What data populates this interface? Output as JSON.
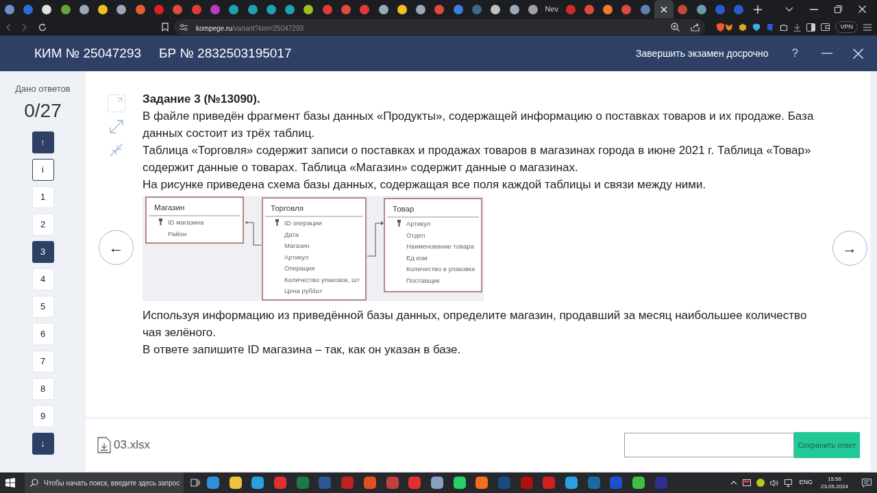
{
  "browser": {
    "tabs": [
      {
        "color": "#6d8fc9",
        "selected": false
      },
      {
        "color": "#2e6ad8",
        "selected": false
      },
      {
        "color": "#e0e0e0",
        "selected": false
      },
      {
        "color": "#6aa040",
        "selected": false
      },
      {
        "color": "#9aa8b8",
        "selected": false
      },
      {
        "color": "#f0c020",
        "selected": false
      },
      {
        "color": "#9aa8b8",
        "selected": false
      },
      {
        "color": "#e06030",
        "selected": false
      },
      {
        "color": "#e02020",
        "selected": false
      },
      {
        "color": "#e04a3a",
        "selected": false
      },
      {
        "color": "#e03a3a",
        "selected": false
      },
      {
        "color": "#c03ac0",
        "selected": false
      },
      {
        "color": "#20a0b0",
        "selected": false
      },
      {
        "color": "#20a0b0",
        "selected": false
      },
      {
        "color": "#20a0b0",
        "selected": false
      },
      {
        "color": "#20a0b0",
        "selected": false
      },
      {
        "color": "#a0c020",
        "selected": false
      },
      {
        "color": "#e03a3a",
        "selected": false
      },
      {
        "color": "#e04a3a",
        "selected": false
      },
      {
        "color": "#e03a3a",
        "selected": false
      },
      {
        "color": "#9aa8b8",
        "selected": false
      },
      {
        "color": "#f0c020",
        "selected": false
      },
      {
        "color": "#9aa8b8",
        "selected": false
      },
      {
        "color": "#e04a3a",
        "selected": false
      },
      {
        "color": "#3a80e0",
        "selected": false
      },
      {
        "color": "#3a6a90",
        "selected": false
      },
      {
        "color": "#c0c0c0",
        "selected": false
      },
      {
        "color": "#9aa8b8",
        "selected": false
      },
      {
        "color": "#a0a0a0",
        "selected": false
      },
      {
        "label": "Nev",
        "selected": false
      },
      {
        "color": "#d02a2a",
        "selected": false
      },
      {
        "color": "#e04a3a",
        "selected": false
      },
      {
        "color": "#f07a30",
        "selected": false
      },
      {
        "color": "#e04a3a",
        "selected": false
      },
      {
        "color": "#6080b0",
        "selected": false
      },
      {
        "selected": true
      },
      {
        "color": "#c04a3a",
        "selected": false
      },
      {
        "color": "#6a9aaa",
        "selected": false
      },
      {
        "color": "#2a5ad0",
        "selected": false
      },
      {
        "color": "#2a5ad0",
        "selected": false
      }
    ],
    "address": {
      "host": "kompege.ru",
      "path": "/variant?kim=25047293"
    },
    "vpn": "VPN"
  },
  "header": {
    "kim": "КИМ № 25047293",
    "br": "БР № 2832503195017",
    "finish": "Завершить экзамен досрочно",
    "help": "?"
  },
  "sidebar": {
    "caption": "Дано ответов",
    "count": "0/27",
    "up": "↑",
    "info": "i",
    "down": "↓",
    "items": [
      {
        "label": "1",
        "selected": false
      },
      {
        "label": "2",
        "selected": false
      },
      {
        "label": "3",
        "selected": true
      },
      {
        "label": "4",
        "selected": false
      },
      {
        "label": "5",
        "selected": false
      },
      {
        "label": "6",
        "selected": false
      },
      {
        "label": "7",
        "selected": false
      },
      {
        "label": "8",
        "selected": false
      },
      {
        "label": "9",
        "selected": false
      }
    ]
  },
  "nav": {
    "prev": "←",
    "next": "→"
  },
  "task": {
    "title": "Задание 3 (№13090).",
    "paragraphs": [
      "В файле приведён фрагмент базы данных «Продукты», содержащей информацию о поставках товаров и их продаже. База данных состоит из трёх таблиц.",
      "Таблица «Торговля» содержит записи о поставках и продажах товаров в магазинах города в июне 2021 г. Таблица «Товар» содержит данные о товарах. Таблица «Магазин» содержит данные о магазинах.",
      "На рисунке приведена схема базы данных, содержащая все поля каждой таблицы и связи между ними."
    ],
    "schema": {
      "tables": [
        {
          "name": "Магазин",
          "fields": [
            {
              "name": "ID магазина",
              "key": true
            },
            {
              "name": "Район",
              "key": false
            }
          ]
        },
        {
          "name": "Торговля",
          "fields": [
            {
              "name": "ID операции",
              "key": true
            },
            {
              "name": "Дата",
              "key": false
            },
            {
              "name": "Магазин",
              "key": false
            },
            {
              "name": "Артикул",
              "key": false
            },
            {
              "name": "Операция",
              "key": false
            },
            {
              "name": "Количество упаковок, шт",
              "key": false
            },
            {
              "name": "Цена руб/шт",
              "key": false
            }
          ]
        },
        {
          "name": "Товар",
          "fields": [
            {
              "name": "Артикул",
              "key": true
            },
            {
              "name": "Отдел",
              "key": false
            },
            {
              "name": "Наименование товара",
              "key": false
            },
            {
              "name": "Ед изм",
              "key": false
            },
            {
              "name": "Количество в упаковке",
              "key": false
            },
            {
              "name": "Поставщик",
              "key": false
            }
          ]
        }
      ]
    },
    "question": [
      "Используя информацию из приведённой базы данных, определите магазин, продавший за месяц наибольшее количество чая зелёного.",
      "В ответе запишите ID магазина – так, как он указан в базе."
    ]
  },
  "footer": {
    "file": "03.xlsx",
    "save_button": "Сохранить ответ"
  },
  "taskbar": {
    "search_placeholder": "Чтобы начать поиск, введите здесь запрос",
    "apps": [
      {
        "color": "#2f8fd8"
      },
      {
        "color": "#f0c040"
      },
      {
        "color": "#2aa0e0"
      },
      {
        "color": "#e03030"
      },
      {
        "color": "#1d7a45"
      },
      {
        "color": "#2b5797"
      },
      {
        "color": "#c02020"
      },
      {
        "color": "#e05020"
      },
      {
        "color": "#c04040"
      },
      {
        "color": "#e03030"
      },
      {
        "color": "#8aa0c0"
      },
      {
        "color": "#25d366"
      },
      {
        "color": "#f07020"
      },
      {
        "color": "#1a4a80"
      },
      {
        "color": "#b01010"
      },
      {
        "color": "#d02020"
      },
      {
        "color": "#2aa0e0"
      },
      {
        "color": "#1a6aa0"
      },
      {
        "color": "#2050d0"
      },
      {
        "color": "#40c040"
      },
      {
        "color": "#303090"
      }
    ],
    "language": "ENG",
    "time": "15:56",
    "date": "23.05.2024"
  }
}
